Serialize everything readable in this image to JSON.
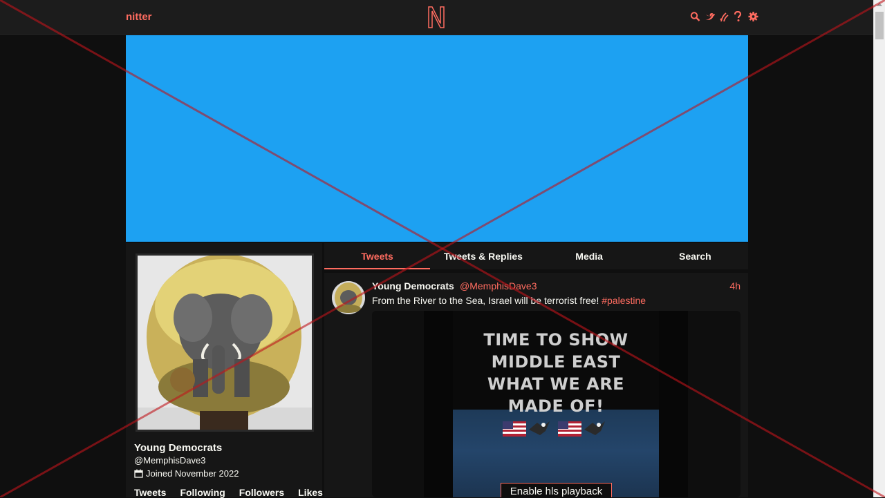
{
  "nav": {
    "brand": "nitter",
    "icons": [
      "search-icon",
      "bird-icon",
      "rss-icon",
      "help-icon",
      "gear-icon"
    ]
  },
  "colors": {
    "accent": "#ff6c60",
    "banner": "#1da1f2",
    "background": "#0f0f0f",
    "panel": "#161616"
  },
  "profile": {
    "fullname": "Young Democrats",
    "username": "@MemphisDave3",
    "joined": "Joined November 2022",
    "stats": [
      "Tweets",
      "Following",
      "Followers",
      "Likes"
    ]
  },
  "tabs": [
    "Tweets",
    "Tweets & Replies",
    "Media",
    "Search"
  ],
  "tweet": {
    "fullname": "Young Democrats",
    "username": "@MemphisDave3",
    "date": "4h",
    "text": "From the River to the Sea, Israel will be terrorist free! ",
    "hashtag": "#palestine",
    "media_text": [
      "TIME TO SHOW",
      "MIDDLE EAST",
      "WHAT WE ARE",
      "MADE OF!"
    ],
    "playback_label": "Enable hls playback"
  }
}
